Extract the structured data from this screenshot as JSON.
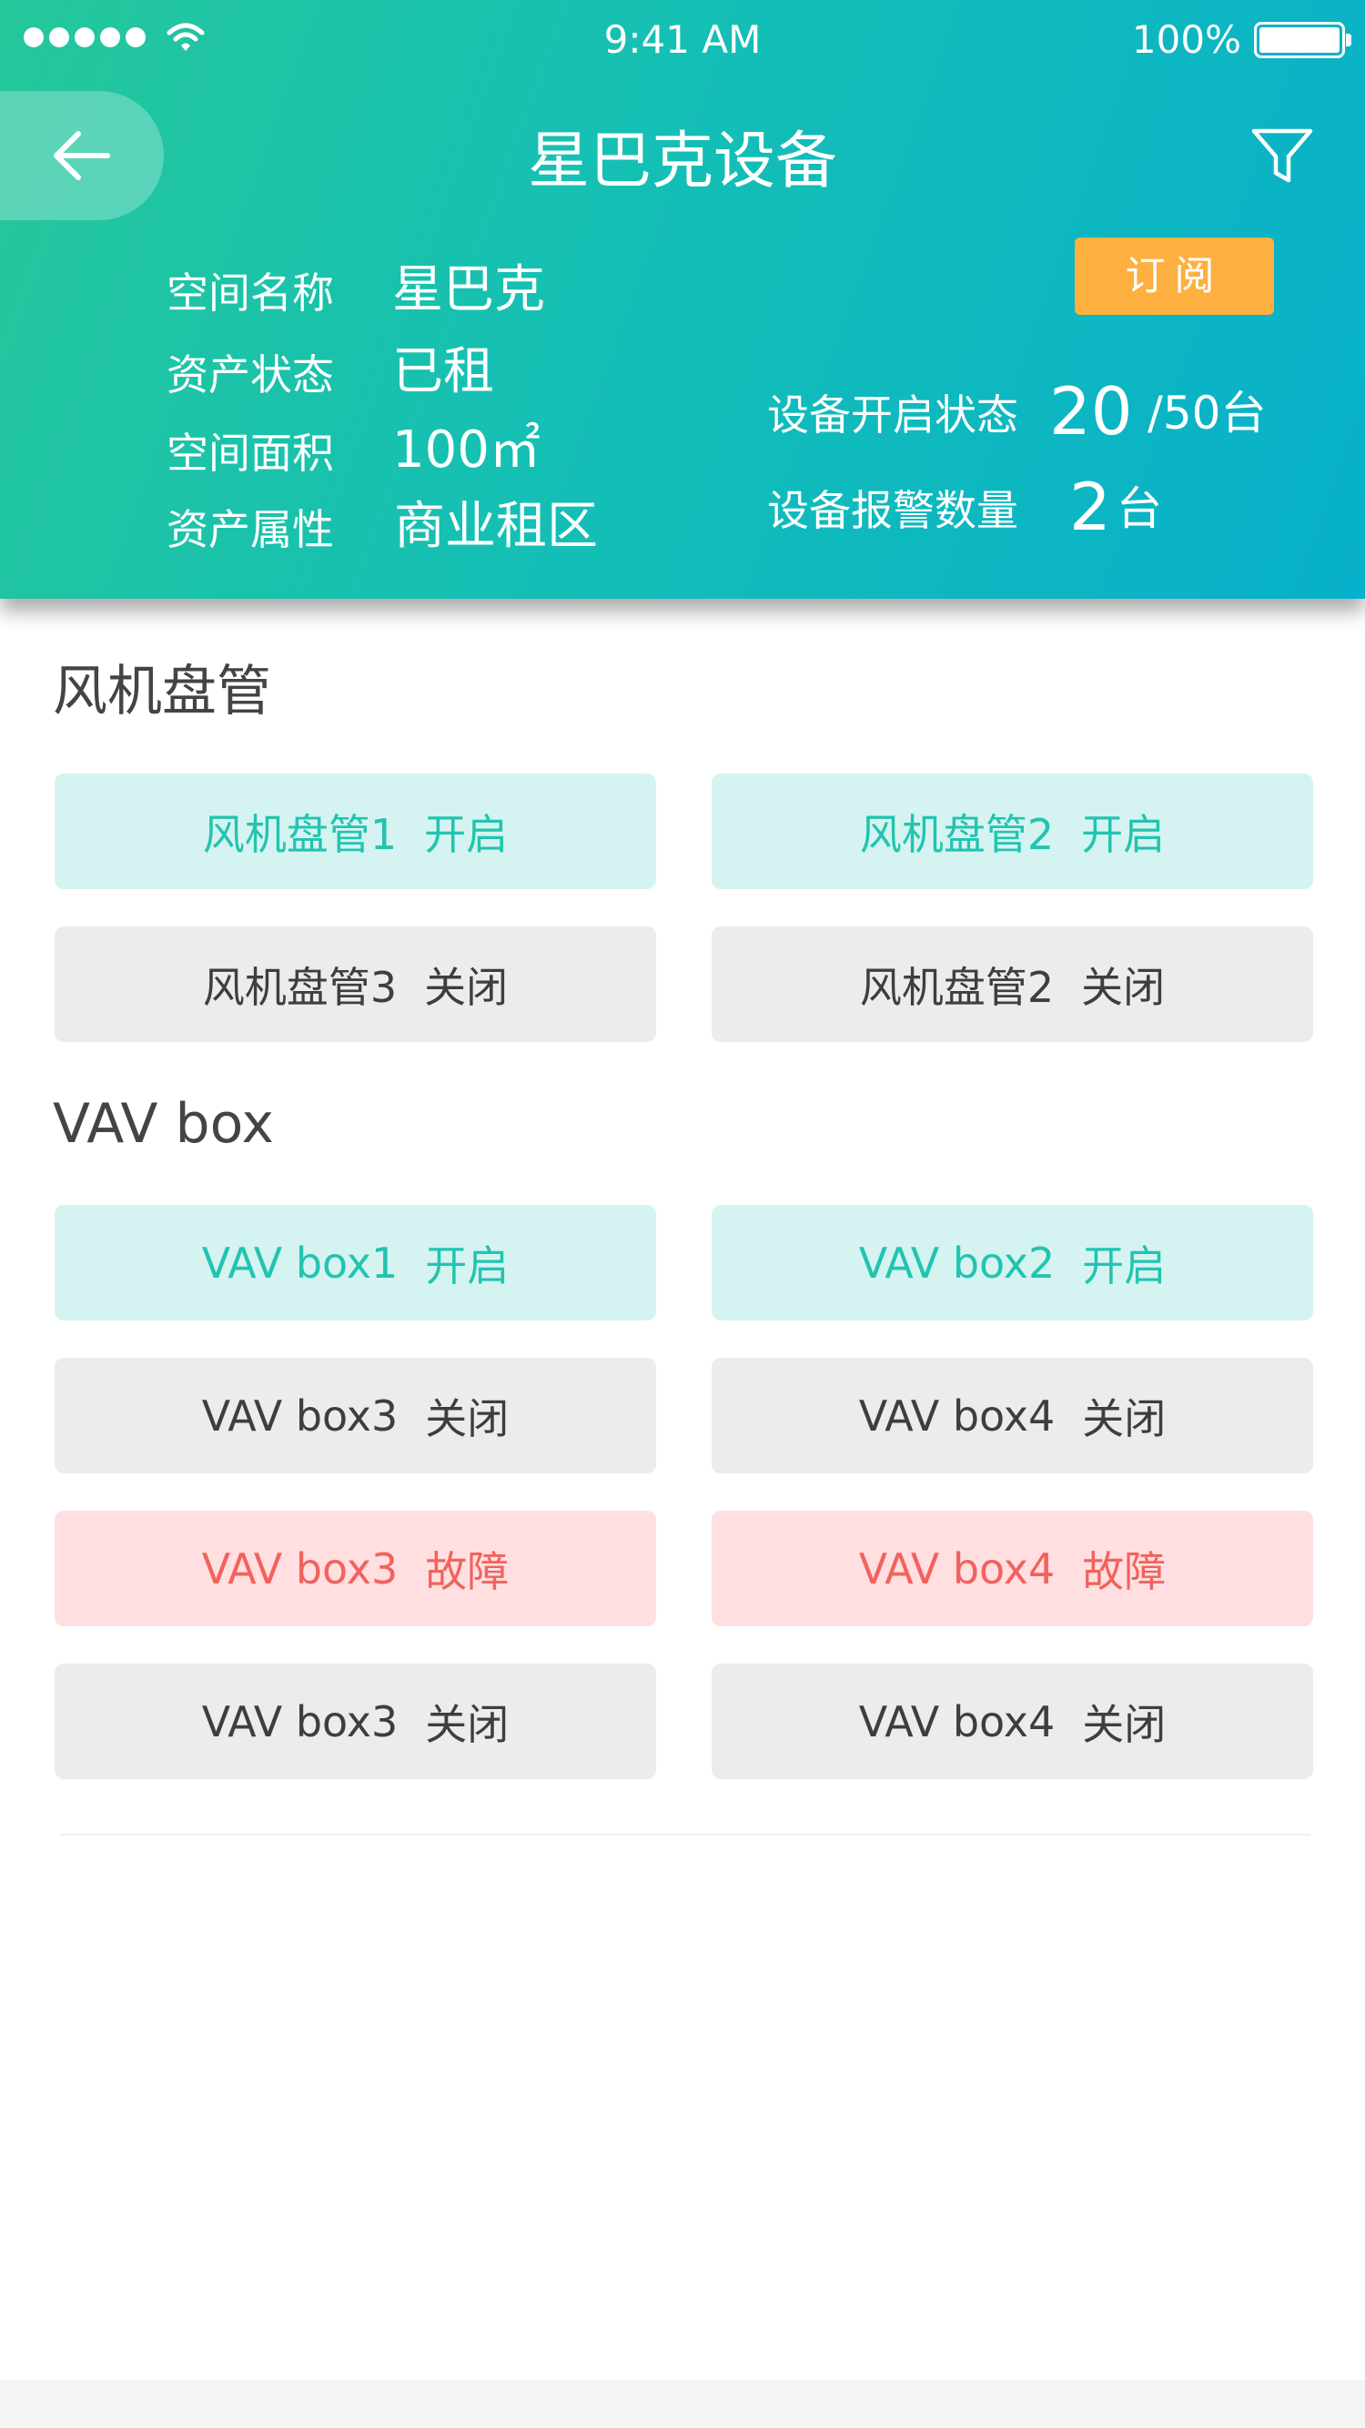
{
  "status_bar": {
    "time": "9:41 AM",
    "battery_percent": "100%",
    "signal_strength_bars": 5,
    "icons": [
      "signal-dots",
      "wifi-icon",
      "battery-icon"
    ]
  },
  "header": {
    "title": "星巴克设备",
    "back_icon": "arrow-left-icon",
    "filter_icon": "filter-icon",
    "subscribe_label": "订阅",
    "background_colors": [
      "#25c79a",
      "#07b0cb"
    ],
    "accent_color": "#fdb03f"
  },
  "space_info": [
    {
      "label": "空间名称",
      "value": "星巴克"
    },
    {
      "label": "资产状态",
      "value": "已租"
    },
    {
      "label": "空间面积",
      "value": "100㎡"
    },
    {
      "label": "资产属性",
      "value": "商业租区"
    }
  ],
  "device_stats": {
    "open_status": {
      "label": "设备开启状态",
      "value": "20",
      "unit": "/50台"
    },
    "alarm_count": {
      "label": "设备报警数量",
      "value": "2",
      "unit": "台"
    }
  },
  "sections": [
    {
      "title": "风机盘管",
      "devices": [
        {
          "name": "风机盘管1",
          "status": "开启",
          "state": "on"
        },
        {
          "name": "风机盘管2",
          "status": "开启",
          "state": "on"
        },
        {
          "name": "风机盘管3",
          "status": "关闭",
          "state": "off"
        },
        {
          "name": "风机盘管2",
          "status": "关闭",
          "state": "off"
        }
      ]
    },
    {
      "title": "VAV box",
      "devices": [
        {
          "name": "VAV box1",
          "status": "开启",
          "state": "on"
        },
        {
          "name": "VAV box2",
          "status": "开启",
          "state": "on"
        },
        {
          "name": "VAV box3",
          "status": "关闭",
          "state": "off"
        },
        {
          "name": "VAV box4",
          "status": "关闭",
          "state": "off"
        },
        {
          "name": "VAV box3",
          "status": "故障",
          "state": "fault"
        },
        {
          "name": "VAV box4",
          "status": "故障",
          "state": "fault"
        },
        {
          "name": "VAV box3",
          "status": "关闭",
          "state": "off"
        },
        {
          "name": "VAV box4",
          "status": "关闭",
          "state": "off"
        }
      ]
    }
  ],
  "status_colors": {
    "on": "#22c4b0",
    "off": "#3e3e3e",
    "fault": "#f2625d"
  }
}
